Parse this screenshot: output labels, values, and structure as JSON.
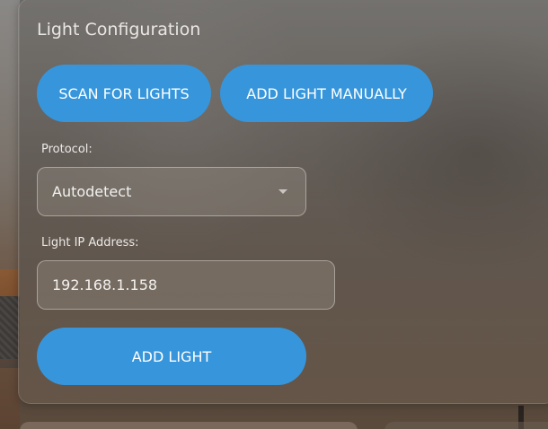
{
  "panel": {
    "title": "Light Configuration"
  },
  "actions": {
    "scan_label": "SCAN FOR LIGHTS",
    "manual_label": "ADD LIGHT MANUALLY",
    "add_label": "ADD LIGHT"
  },
  "protocol": {
    "label": "Protocol:",
    "selected": "Autodetect"
  },
  "ip": {
    "label": "Light IP Address:",
    "value": "192.168.1.158"
  },
  "colors": {
    "accent": "#3796db"
  },
  "icons": {
    "dropdown": "chevron-down-icon"
  }
}
